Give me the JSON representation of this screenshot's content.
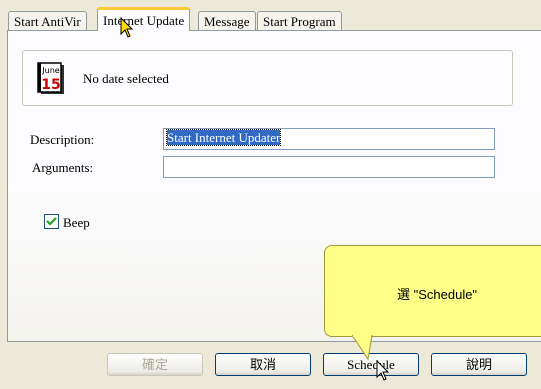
{
  "tabs": [
    {
      "label": "Start AntiVir",
      "active": false
    },
    {
      "label": "Internet Update",
      "active": true
    },
    {
      "label": "Message",
      "active": false
    },
    {
      "label": "Start Program",
      "active": false
    }
  ],
  "schedule": {
    "calendar_month": "June",
    "calendar_day": "15",
    "date_status": "No date selected"
  },
  "form": {
    "description_label": "Description:",
    "description_value": "Start Internet Updater",
    "arguments_label": "Arguments:",
    "arguments_value": "",
    "beep_label": "Beep",
    "beep_checked": true
  },
  "buttons": {
    "ok": "確定",
    "cancel": "取消",
    "schedule": "Schedule",
    "help": "說明"
  },
  "callout": {
    "text": "選 \"Schedule\""
  },
  "colors": {
    "active_tab_accent": "#ffc83c",
    "callout_background": "#ffff88",
    "selection": "#316ac5"
  }
}
